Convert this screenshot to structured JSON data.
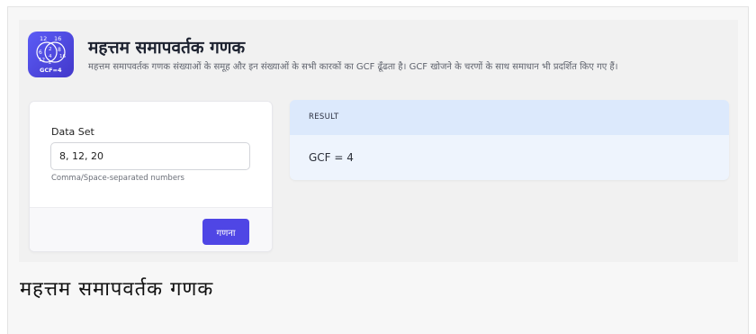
{
  "header": {
    "title": "महत्तम समापवर्तक गणक",
    "subtitle": "महत्तम समापवर्तक गणक संख्याओं के समूह और इन संख्याओं के सभी कारकों का GCF ढूँढता है। GCF खोजने के चरणों के साथ समाधान भी प्रदर्शित किए गए हैं।"
  },
  "logo": {
    "icon": "venn-diagram-icon",
    "numbers": [
      "12",
      "16",
      "6",
      "2",
      "8",
      "4",
      "16",
      "12",
      "2"
    ],
    "caption": "GCF=4",
    "colors": {
      "background": "#4f46e5",
      "accent": "#f59e0b"
    }
  },
  "form": {
    "dataset_label": "Data Set",
    "dataset_value": "8, 12, 20",
    "hint": "Comma/Space-separated numbers",
    "calculate_label": "गणना"
  },
  "result": {
    "label": "RESULT",
    "value": "GCF = 4"
  },
  "footer": {
    "text": "महत्तम समापवर्तक गणक"
  },
  "colors": {
    "primary": "#4f46e5",
    "result_header": "#dce9fc",
    "result_body": "#eef4fd"
  }
}
